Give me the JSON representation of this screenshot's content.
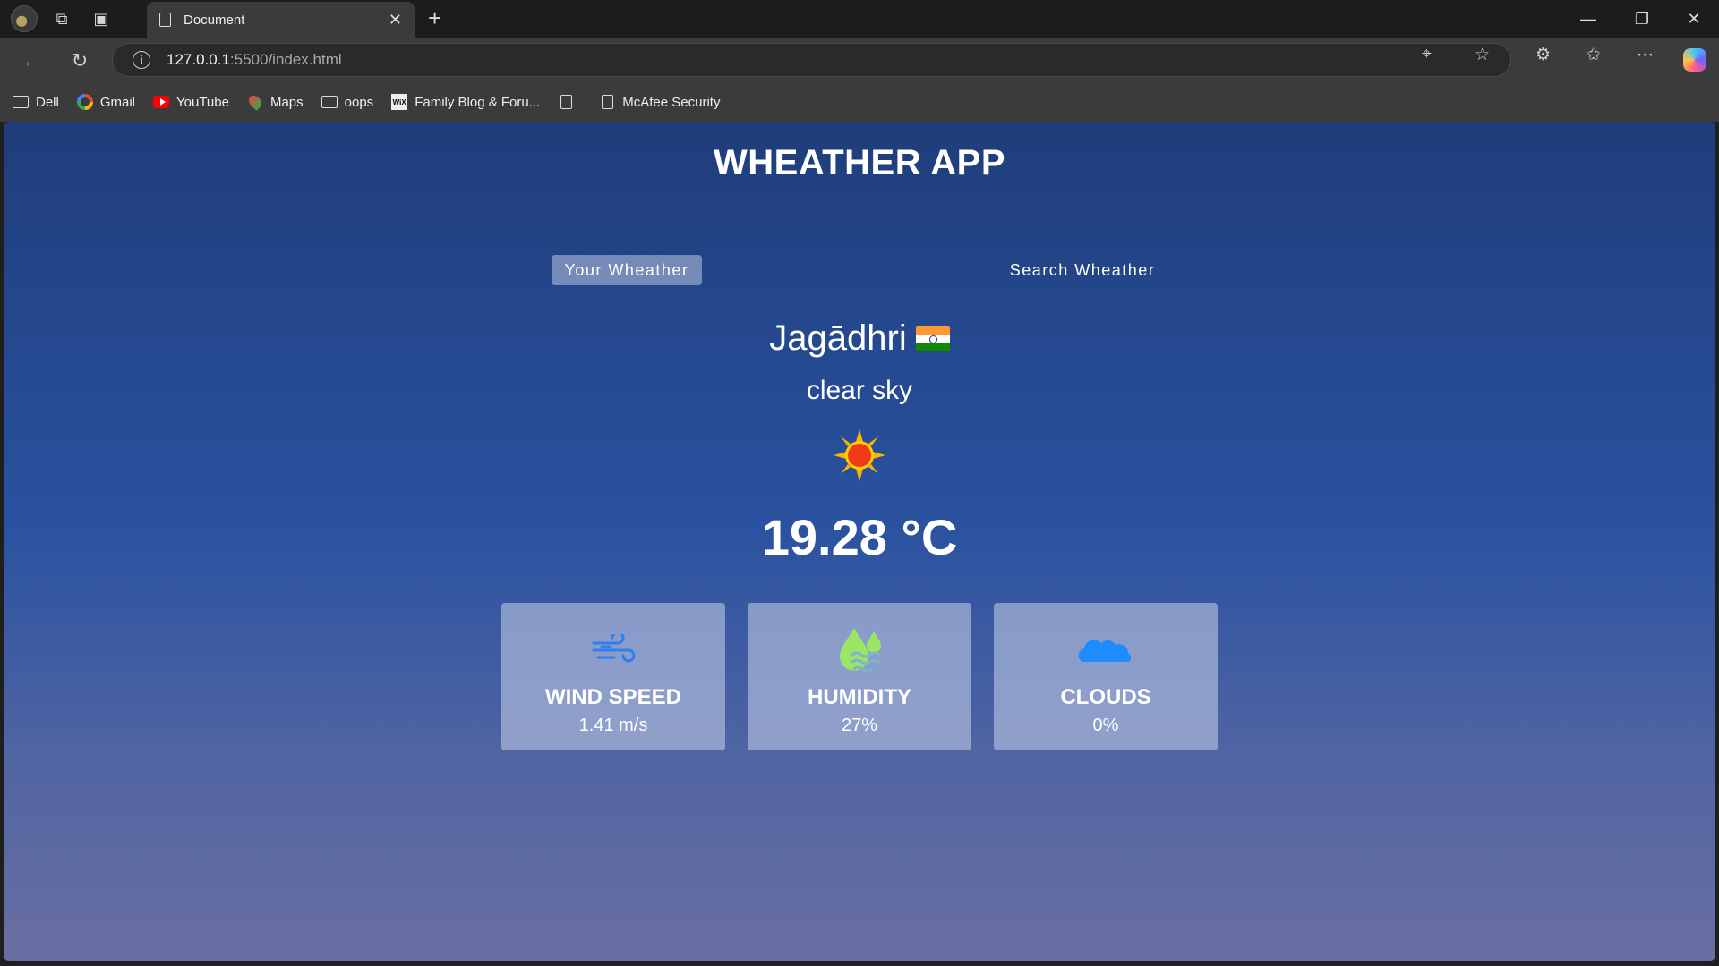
{
  "browser": {
    "tab_title": "Document",
    "url_host": "127.0.0.1",
    "url_path": ":5500/index.html",
    "bookmarks": [
      {
        "label": "Dell",
        "icon": "folder-icon"
      },
      {
        "label": "Gmail",
        "icon": "google-icon"
      },
      {
        "label": "YouTube",
        "icon": "youtube-icon"
      },
      {
        "label": "Maps",
        "icon": "maps-icon"
      },
      {
        "label": "oops",
        "icon": "folder-icon"
      },
      {
        "label": "Family Blog & Foru...",
        "icon": "wix-icon"
      },
      {
        "label": "",
        "icon": "page-icon"
      },
      {
        "label": "McAfee Security",
        "icon": "page-icon"
      }
    ]
  },
  "app": {
    "title": "WHEATHER APP",
    "tabs": {
      "your_weather": "Your Wheather",
      "search_weather": "Search Wheather"
    },
    "city": "Jagādhri",
    "country_flag": "india-flag-icon",
    "description": "clear sky",
    "weather_icon": "sun-icon",
    "temperature": "19.28 °C",
    "cards": [
      {
        "title": "WIND SPEED",
        "value": "1.41 m/s",
        "icon": "wind-icon"
      },
      {
        "title": "HUMIDITY",
        "value": "27%",
        "icon": "humidity-icon"
      },
      {
        "title": "CLOUDS",
        "value": "0%",
        "icon": "cloud-icon"
      }
    ]
  },
  "colors": {
    "bg_top": "#1f3d7a",
    "bg_bottom": "#6a6fa2",
    "card_bg": "#8f9cc6",
    "wind_icon": "#2f80ed",
    "humidity_icon": "#9be564",
    "cloud_icon": "#1e8cff"
  }
}
